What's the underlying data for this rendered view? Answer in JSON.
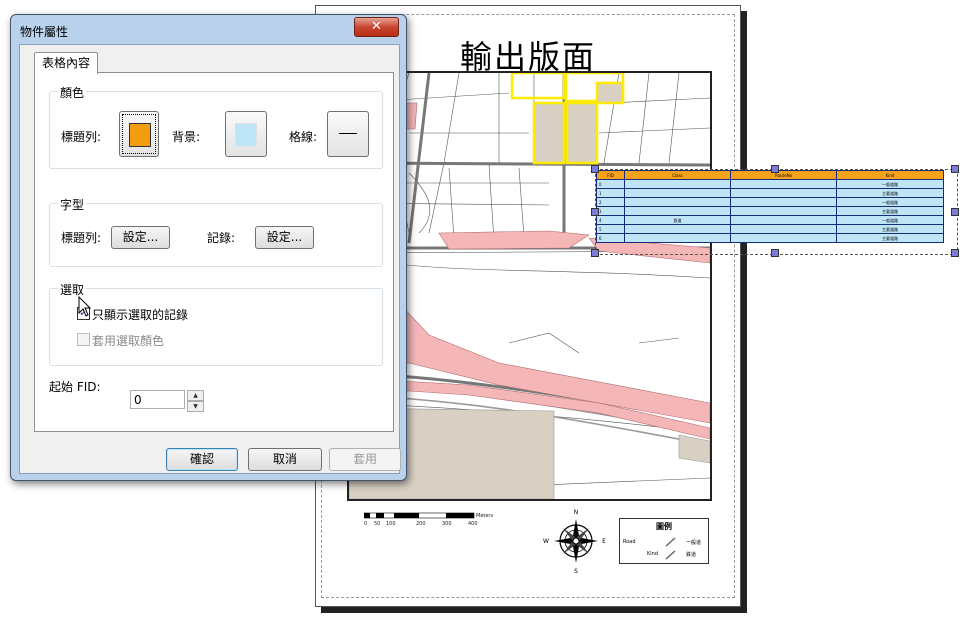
{
  "layout": {
    "title": "輸出版面",
    "scale_ticks": [
      "0",
      "50",
      "100",
      "200",
      "300",
      "400"
    ],
    "scale_unit": "Meters",
    "north": {
      "n": "N",
      "s": "S",
      "e": "E",
      "w": "W"
    },
    "legend": {
      "title": "圖例",
      "items": [
        {
          "label": "Road",
          "value": "一般道"
        },
        {
          "label": "Kind",
          "value": "鉄道"
        }
      ]
    },
    "table": {
      "headers": [
        "FID",
        "Class",
        "RouteNo",
        "Kind"
      ],
      "rows": [
        [
          "0",
          "",
          "",
          "一般道路"
        ],
        [
          "1",
          "",
          "",
          "主要道路"
        ],
        [
          "2",
          "",
          "",
          "一般道路"
        ],
        [
          "3",
          "",
          "",
          "主要道路"
        ],
        [
          "4",
          "鉄道",
          "",
          "一般道路"
        ],
        [
          "5",
          "",
          "",
          "主要道路"
        ],
        [
          "6",
          "",
          "",
          "主要道路"
        ]
      ]
    }
  },
  "dialog": {
    "title": "物件屬性",
    "close_label": "✕",
    "tab_label": "表格內容",
    "color_group": {
      "label": "顏色",
      "header_label": "標題列:",
      "background_label": "背景:",
      "grid_label": "格線:",
      "header_color": "#f39c12",
      "background_color": "#bfe6f7",
      "grid_line": "—"
    },
    "font_group": {
      "label": "字型",
      "header_label": "標題列:",
      "record_label": "記錄:",
      "header_button": "設定...",
      "record_button": "設定..."
    },
    "selection_group": {
      "label": "選取",
      "only_selected_label": "只顯示選取的記錄",
      "only_selected_checked": true,
      "apply_sel_color_label": "套用選取顏色",
      "apply_sel_color_checked": false
    },
    "start_fid_label": "起始 FID:",
    "start_fid_value": "0",
    "ok_button": "確認",
    "cancel_button": "取消",
    "apply_button": "套用"
  }
}
